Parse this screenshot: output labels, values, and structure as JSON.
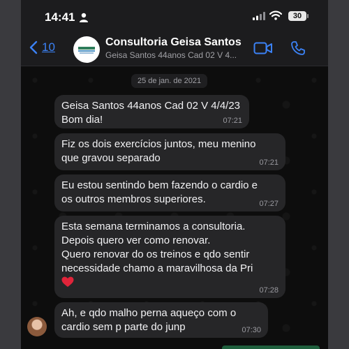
{
  "status_bar": {
    "time": "14:41",
    "battery": "30"
  },
  "header": {
    "back_count": "10",
    "title": "Consultoria Geisa Santos",
    "subtitle": "Geisa Santos 44anos Cad 02 V 4..."
  },
  "chat": {
    "date": "25 de jan. de 2021",
    "messages": [
      {
        "sender": "Geisa Santos 44anos Cad 02 V 4/4/23",
        "text": "Bom dia!",
        "time": "07:21"
      },
      {
        "text": "Fiz os dois exercícios juntos, meu menino\nque gravou separado",
        "time": "07:21"
      },
      {
        "text": "Eu estou sentindo bem fazendo o cardio e\nos outros membros superiores.",
        "time": "07:27"
      },
      {
        "text": "Esta semana terminamos a consultoria.\nDepois quero ver como renovar.\nQuero renovar do os treinos e qdo sentir\nnecessidade chamo a maravilhosa da Pri",
        "emoji": "heart-emoji",
        "time": "07:28"
      },
      {
        "text": "Ah, e qdo malho perna aqueço com o\ncardio sem p parte do junp",
        "time": "07:30"
      }
    ]
  },
  "colors": {
    "accent": "#3b82f6",
    "bubble": "#262628",
    "background": "#0d0d0d"
  }
}
